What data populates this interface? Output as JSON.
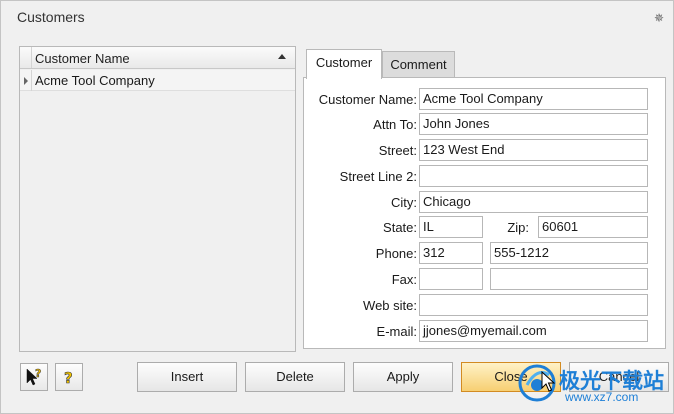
{
  "window": {
    "title": "Customers",
    "close_glyph": "✵"
  },
  "grid": {
    "column_header": "Customer Name",
    "rows": [
      {
        "name": "Acme Tool Company"
      }
    ]
  },
  "tabs": [
    {
      "label": "Customer",
      "active": true
    },
    {
      "label": "Comment",
      "active": false
    }
  ],
  "form": {
    "customer_name": {
      "label": "Customer Name:",
      "value": "Acme Tool Company"
    },
    "attn_to": {
      "label": "Attn To:",
      "value": "John Jones"
    },
    "street": {
      "label": "Street:",
      "value": "123 West End"
    },
    "street2": {
      "label": "Street Line 2:",
      "value": ""
    },
    "city": {
      "label": "City:",
      "value": "Chicago"
    },
    "state": {
      "label": "State:",
      "value": "IL"
    },
    "zip": {
      "label": "Zip:",
      "value": "60601"
    },
    "phone": {
      "label": "Phone:",
      "area": "312",
      "number": "555-1212"
    },
    "fax": {
      "label": "Fax:",
      "area": "",
      "number": ""
    },
    "website": {
      "label": "Web site:",
      "value": ""
    },
    "email": {
      "label": "E-mail:",
      "value": "jjones@myemail.com"
    }
  },
  "buttons": {
    "help_pointer_icon": "help-pointer-icon",
    "help_icon": "help-icon",
    "insert": "Insert",
    "delete": "Delete",
    "apply": "Apply",
    "close": "Close",
    "cancel": "Cancel"
  },
  "watermark": {
    "main": "极光下载站",
    "sub": "www.xz7.com"
  },
  "colors": {
    "primary_button": "#f7cf72",
    "watermark": "#1e7fd6"
  }
}
